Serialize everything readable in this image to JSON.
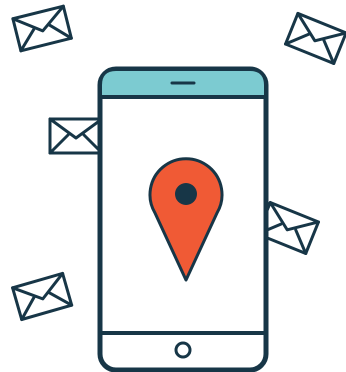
{
  "illustration": {
    "subject": "phone-with-location-pin-and-floating-envelopes",
    "icons": [
      "envelope-icon",
      "smartphone-icon",
      "location-pin-icon",
      "home-button-icon",
      "speaker-slot-icon"
    ],
    "colors": {
      "outline": "#173647",
      "screen_header": "#7ccbd1",
      "pin": "#f05a35",
      "envelope_fill": "#ffffff",
      "phone_body": "#ffffff"
    }
  }
}
